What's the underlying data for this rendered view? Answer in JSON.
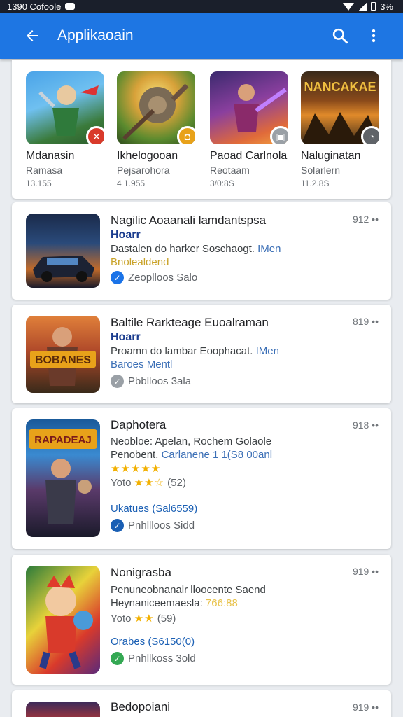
{
  "status_bar": {
    "time": "1390 Cofoole",
    "battery": "3%"
  },
  "app_bar": {
    "title": "Applikaoain",
    "back_icon": "arrow-back-icon",
    "search_icon": "search-icon",
    "more_icon": "more-vert-icon",
    "color": "#1e76e3"
  },
  "featured": [
    {
      "name": "Mdanasin",
      "sub": "Ramasa",
      "meta": "13.155",
      "badge_color": "#d93a2b",
      "badge_icon": "tools-icon"
    },
    {
      "name": "Ikhelogooan",
      "sub": "Pejsarohora",
      "meta": "4 1.955",
      "badge_color": "#e8a21a",
      "badge_icon": "shield-icon"
    },
    {
      "name": "Paoad Carlnola",
      "sub": "Reotaam",
      "meta": "3/0:8S",
      "badge_color": "#9aa0a6",
      "badge_icon": "box-icon"
    },
    {
      "name": "Naluginatan",
      "sub": "Solarlern",
      "meta": "11.2.8S",
      "badge_color": "#5f6368",
      "badge_icon": "timer-icon"
    }
  ],
  "apps": [
    {
      "title": "Nagilic Aoaanali lamdantspsa",
      "developer": "Hoarr",
      "desc": "Dastalen do harker Soschaogt.",
      "desc_hl": "IMen",
      "tag": "Bnolealdend",
      "status": "Zeoplloos Salo",
      "menu": "912 ••",
      "status_color": "#1a73e8"
    },
    {
      "title": "Baltile Rarkteage Euoalraman",
      "developer": "Hoarr",
      "desc": "Proamn do lambar Eoophacat.",
      "desc_hl": "IMen",
      "tag": "Baroes Mentl",
      "status": "Pbblloos 3ala",
      "menu": "819 ••",
      "status_color": "#9aa0a6"
    },
    {
      "title": "Daphotera",
      "line2": "Neobloe: Apelan, Rochem Golaole",
      "line3_a": "Penobent.",
      "line3_b": "Carlanene 1 1(S8 00anl",
      "stars": "★★★★★",
      "rating_label": "Yoto",
      "rating_stars": "★★☆",
      "rating_count": "(52)",
      "link": "Ukatues (Sal6559)",
      "status": "Pnhllloos Sidd",
      "menu": "918 ••",
      "status_color": "#1a5fb4"
    },
    {
      "title": "Nonigrasba",
      "line2": "Penuneobnanalr lloocente Saend",
      "line3_a": "Heynaniceemaesla:",
      "line3_b": "766:88",
      "rating_label": "Yoto",
      "rating_stars": "★★",
      "rating_count": "(59)",
      "link": "Orabes (S6150(0)",
      "status": "Pnhllkoss 3old",
      "menu": "919 ••",
      "status_color": "#34a853"
    },
    {
      "title": "Bedopoiani",
      "menu": "919 ••"
    }
  ]
}
